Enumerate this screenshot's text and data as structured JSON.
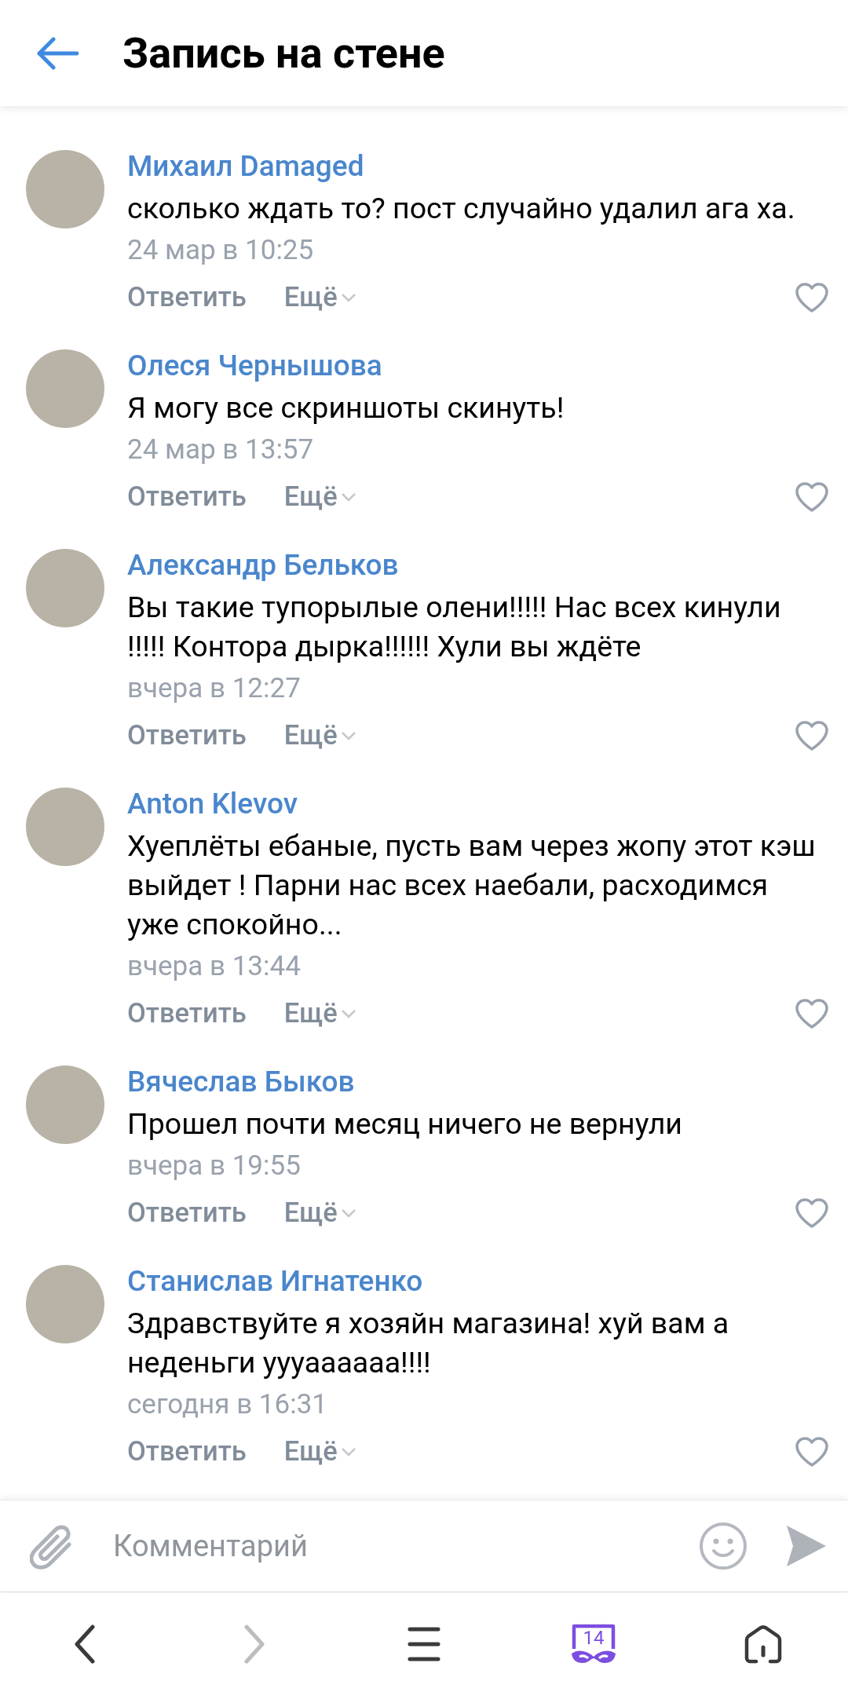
{
  "header": {
    "title": "Запись на стене"
  },
  "comments": [
    {
      "author": "Михаил Damaged",
      "text": "сколько ждать то? пост случайно удалил ага ха.",
      "time": "24 мар в 10:25",
      "reply": "Ответить",
      "more": "Ещё"
    },
    {
      "author": "Олеся Чернышова",
      "text": "Я могу все скриншоты скинуть!",
      "time": "24 мар в 13:57",
      "reply": "Ответить",
      "more": "Ещё"
    },
    {
      "author": "Александр Бельков",
      "text": "Вы такие тупорылые олени!!!!! Нас всех кинули !!!!! Контора дырка!!!!!! Хули вы ждёте",
      "time": "вчера в 12:27",
      "reply": "Ответить",
      "more": "Ещё"
    },
    {
      "author": "Anton Klevov",
      "text": "Хуеплёты ебаные, пусть вам через жопу этот кэш выйдет ! Парни нас всех наебали, расходимся уже спокойно...",
      "time": "вчера в 13:44",
      "reply": "Ответить",
      "more": "Ещё"
    },
    {
      "author": "Вячеслав Быков",
      "text": "Прошел почти месяц ничего не вернули",
      "time": "вчера в 19:55",
      "reply": "Ответить",
      "more": "Ещё"
    },
    {
      "author": "Станислав Игнатенко",
      "text": "Здравствуйте я хозяйн магазина! хуй вам а неденьги уууаааааа!!!!",
      "time": "сегодня в 16:31",
      "reply": "Ответить",
      "more": "Ещё"
    }
  ],
  "composer": {
    "placeholder": "Комментарий"
  },
  "browser_bar": {
    "tabs_count": "14"
  }
}
